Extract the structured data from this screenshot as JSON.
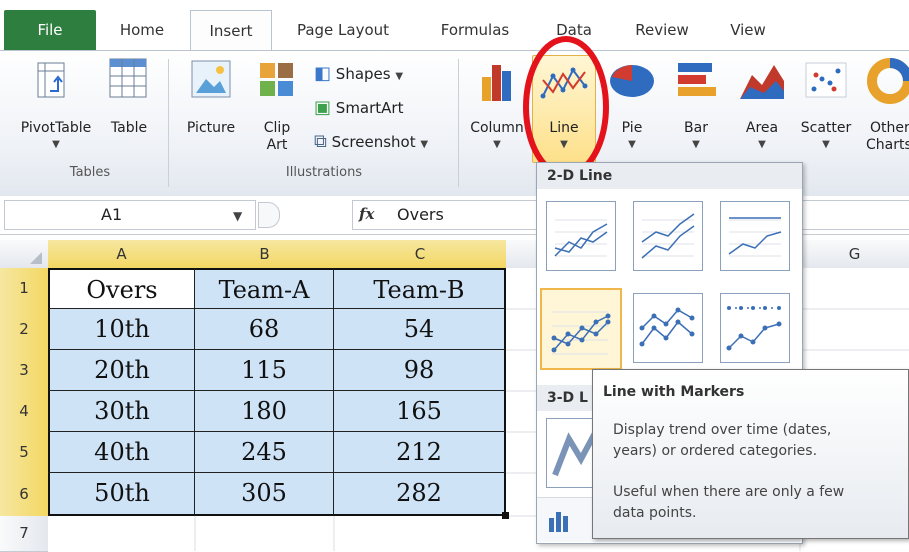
{
  "tabs": [
    "File",
    "Home",
    "Insert",
    "Page Layout",
    "Formulas",
    "Data",
    "Review",
    "View"
  ],
  "groups": {
    "tables": {
      "label": "Tables",
      "pivot_label": "PivotTable",
      "table_label": "Table"
    },
    "illustrations": {
      "label": "Illustrations",
      "picture_label": "Picture",
      "clip_label_1": "Clip",
      "clip_label_2": "Art",
      "shapes_label": "Shapes",
      "smartart_label": "SmartArt",
      "screenshot_label": "Screenshot"
    },
    "charts": {
      "column_label": "Column",
      "line_label": "Line",
      "pie_label": "Pie",
      "bar_label": "Bar",
      "area_label": "Area",
      "scatter_label": "Scatter",
      "other_label_1": "Other",
      "other_label_2": "Charts"
    }
  },
  "formula_bar": {
    "name_box": "A1",
    "fx": "fx",
    "content": "Overs"
  },
  "columns": [
    "A",
    "B",
    "C",
    "G"
  ],
  "rows": [
    "1",
    "2",
    "3",
    "4",
    "5",
    "6",
    "7"
  ],
  "table": {
    "headers": [
      "Overs",
      "Team-A",
      "Team-B"
    ],
    "rows": [
      [
        "10th",
        "68",
        "54"
      ],
      [
        "20th",
        "115",
        "98"
      ],
      [
        "30th",
        "180",
        "165"
      ],
      [
        "40th",
        "245",
        "212"
      ],
      [
        "50th",
        "305",
        "282"
      ]
    ]
  },
  "dropdown": {
    "section_2d": "2-D Line",
    "section_3d": "3-D L"
  },
  "tooltip": {
    "title": "Line with Markers",
    "line1": "Display trend over time (dates,",
    "line2": "years) or ordered categories.",
    "line3": "Useful when there are only a few",
    "line4": "data points."
  },
  "colors": {
    "file_tab": "#2d7e3f",
    "selection_fill": "#cfe3f7",
    "header_highlight": "#f3d763",
    "annotation": "#e4121b"
  }
}
